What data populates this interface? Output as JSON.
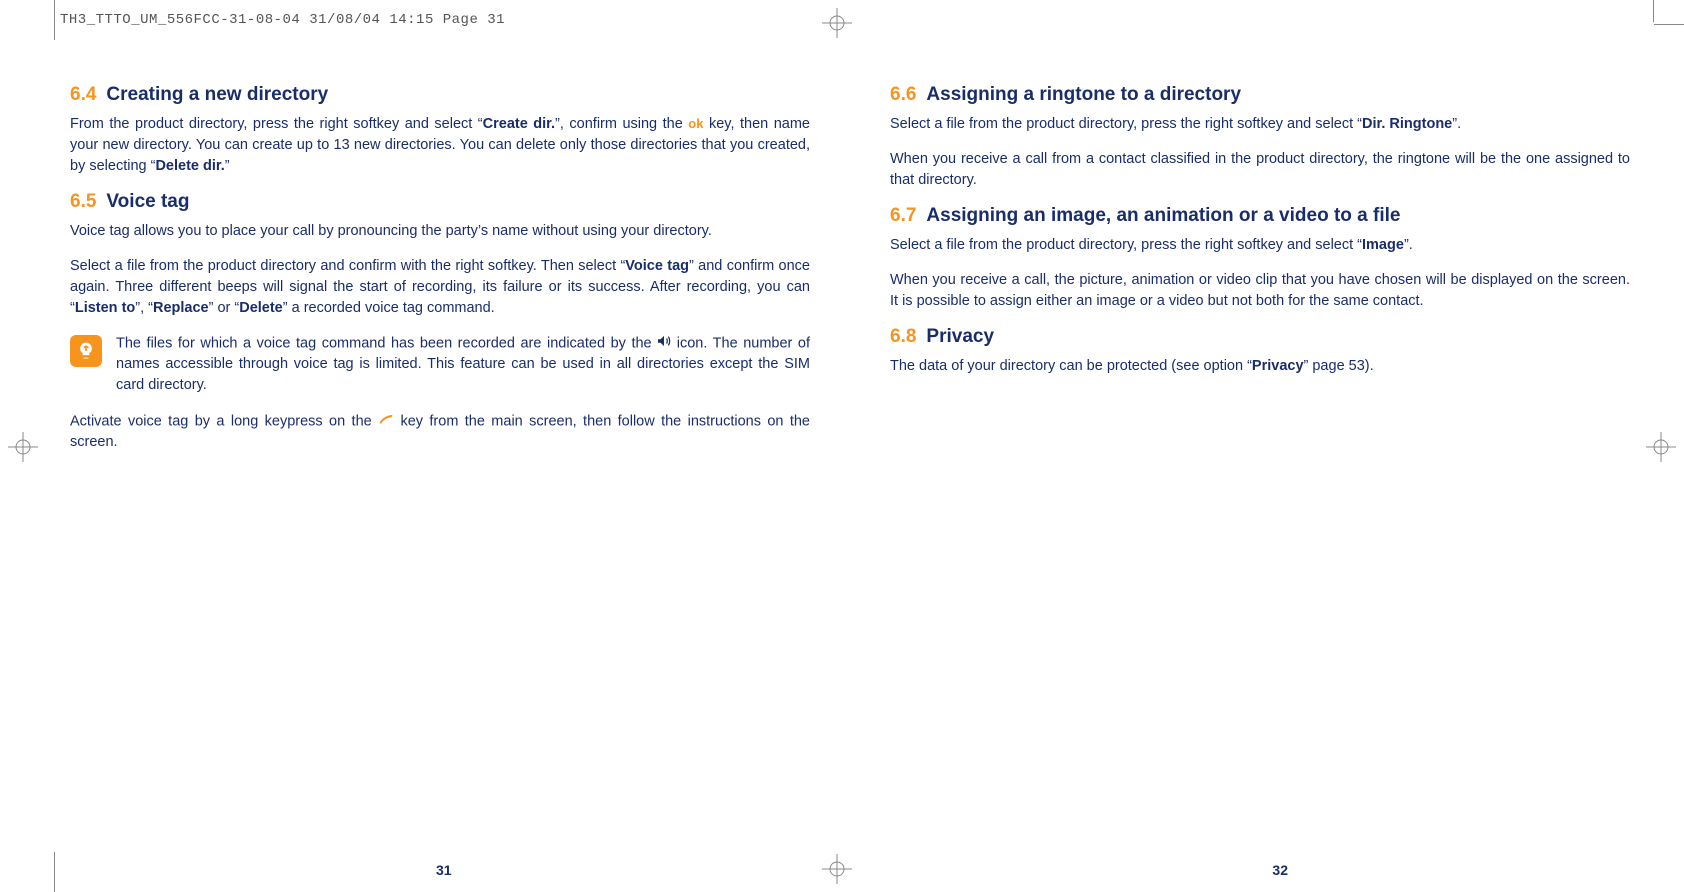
{
  "print_header": "TH3_TTTO_UM_556FCC-31-08-04  31/08/04  14:15  Page 31",
  "left": {
    "s64": {
      "num": "6.4",
      "title": "Creating a new directory",
      "p1a": "From the product directory, press the right softkey and select “",
      "p1b": "Create dir.",
      "p1c": "”, confirm using the ",
      "ok": "ok",
      "p1d": " key, then name your new directory. You can create up to 13 new directories. You can delete only those directories that you created, by selecting “",
      "p1e": "Delete dir.",
      "p1f": "”"
    },
    "s65": {
      "num": "6.5",
      "title": "Voice tag",
      "p1": "Voice tag allows you to place your call by pronouncing the party’s name without using your directory.",
      "p2a": "Select a file from the product directory and confirm with the right softkey. Then select “",
      "p2b": "Voice tag",
      "p2c": "” and confirm once again. Three different beeps will signal the start of recording, its failure or its success. After recording, you can “",
      "p2d": "Listen to",
      "p2e": "”, “",
      "p2f": "Replace",
      "p2g": "” or “",
      "p2h": "Delete",
      "p2i": "” a recorded voice tag command.",
      "tip_a": "The files for which a voice tag command has been recorded are indicated by the ",
      "tip_b": " icon. The number of names accessible through voice tag is limited. This feature can be used in all directories except the SIM card directory.",
      "p3a": "Activate voice tag by a long keypress on the ",
      "p3b": " key from the main screen, then follow the instructions on the screen."
    },
    "pagenum": "31"
  },
  "right": {
    "s66": {
      "num": "6.6",
      "title": "Assigning a ringtone to a directory",
      "p1a": "Select a file from the product directory, press the right softkey and select “",
      "p1b": "Dir. Ringtone",
      "p1c": "”.",
      "p2": "When you receive a call from a contact classified in the product directory, the ringtone will be the one assigned to that directory."
    },
    "s67": {
      "num": "6.7",
      "title": "Assigning an image, an animation or a video to a file",
      "p1a": "Select a file from the product directory, press the right softkey and select “",
      "p1b": "Image",
      "p1c": "”.",
      "p2": "When you receive a call, the picture, animation or video clip that you have chosen will be displayed on the screen. It is possible to assign either an image or a video but not both for the same contact."
    },
    "s68": {
      "num": "6.8",
      "title": "Privacy",
      "p1a": "The data of your directory can be protected (see option “",
      "p1b": "Privacy",
      "p1c": "” page 53)."
    },
    "pagenum": "32"
  }
}
